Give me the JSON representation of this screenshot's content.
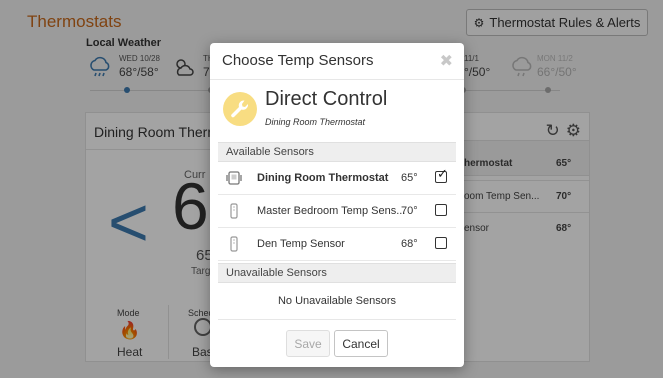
{
  "page": {
    "title": "Thermostats",
    "rules_button": "Thermostat Rules & Alerts",
    "weather_label": "Local Weather",
    "weather": [
      {
        "date": "WED 10/28",
        "temp": "68°/58°"
      },
      {
        "date": "TH",
        "temp": "7"
      },
      {
        "date": "11/1",
        "temp": "°/50°"
      },
      {
        "date": "MON 11/2",
        "temp": "66°/50°"
      }
    ],
    "card": {
      "title": "Dining Room Therm",
      "current_label": "Curr",
      "current_temp": "6",
      "target_temp": "65",
      "target_label": "Targ",
      "mode_label": "Mode",
      "mode_value": "Heat",
      "schedule_label": "Sched",
      "schedule_value": "Bas"
    },
    "side_sensors": [
      {
        "name": "hermostat",
        "temp": "65°"
      },
      {
        "name": "oom Temp Sen...",
        "temp": "70°"
      },
      {
        "name": "ensor",
        "temp": "68°"
      }
    ]
  },
  "modal": {
    "title": "Choose Temp Sensors",
    "close_symbol": "✖",
    "control_title": "Direct Control",
    "control_subtitle": "Dining Room Thermostat",
    "available_header": "Available Sensors",
    "sensors": [
      {
        "name": "Dining Room Thermostat",
        "temp": "65°",
        "checked": true
      },
      {
        "name": "Master Bedroom Temp Sens...",
        "temp": "70°",
        "checked": false
      },
      {
        "name": "Den Temp Sensor",
        "temp": "68°",
        "checked": false
      }
    ],
    "unavailable_header": "Unavailable Sensors",
    "no_unavailable": "No Unavailable Sensors",
    "save_label": "Save",
    "cancel_label": "Cancel"
  },
  "colors": {
    "accent_orange": "#c8691c",
    "accent_blue": "#3d7ab0",
    "badge_yellow": "#f8dd82"
  }
}
